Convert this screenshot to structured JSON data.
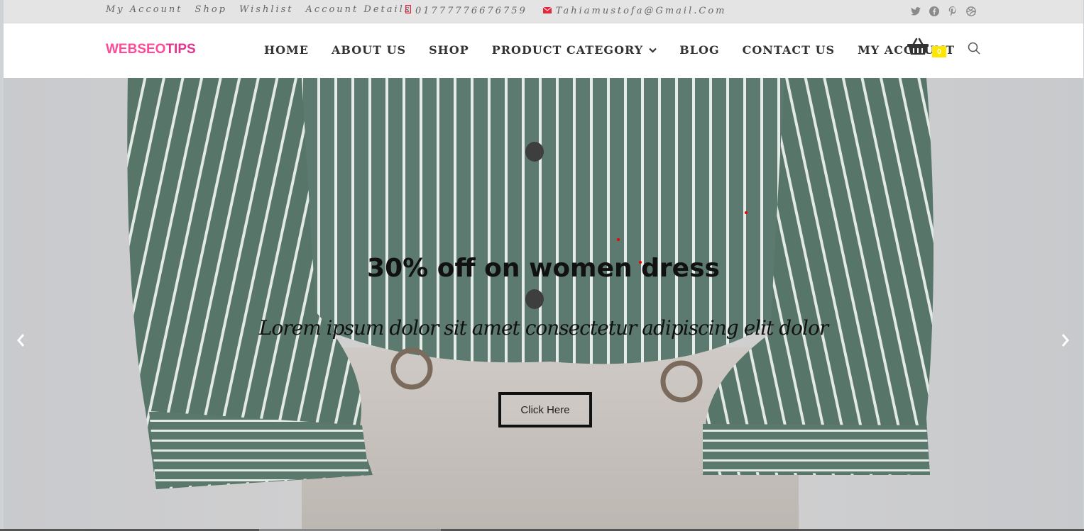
{
  "topbar": {
    "links": [
      {
        "label": "My Account"
      },
      {
        "label": "Shop"
      },
      {
        "label": "Wishlist"
      },
      {
        "label": "Account Details"
      }
    ],
    "phone": "01777776676759",
    "email": "Tahiamustofa@Gmail.Com",
    "phone_icon": "mobile-phone-icon",
    "email_icon": "envelope-icon",
    "social_icons": [
      "twitter-icon",
      "facebook-icon",
      "pinterest-icon",
      "dribbble-icon"
    ]
  },
  "header": {
    "logo_part1": "WEBSEO",
    "logo_part2": "TIPS",
    "nav": [
      {
        "label": "HOME"
      },
      {
        "label": "ABOUT US"
      },
      {
        "label": "SHOP"
      },
      {
        "label": "PRODUCT CATEGORY",
        "has_dropdown": true
      },
      {
        "label": "BLOG"
      },
      {
        "label": "CONTACT US"
      },
      {
        "label": "MY ACCOUNT"
      }
    ],
    "cart_count": "0",
    "cart_icon": "shopping-basket-icon",
    "search_icon": "search-icon"
  },
  "hero": {
    "title": "30% off on women dress",
    "subtitle": "Lorem ipsum dolor sit amet consectetur adipiscing elit dolor",
    "button_label": "Click Here",
    "prev_icon": "chevron-left-icon",
    "next_icon": "chevron-right-icon"
  },
  "colors": {
    "logo_pink": "#ff4a97",
    "logo_magenta": "#e0348f",
    "contact_icon_red": "#e8253d",
    "cart_badge": "#ffe600",
    "topbar_bg": "#e4e4e4"
  }
}
